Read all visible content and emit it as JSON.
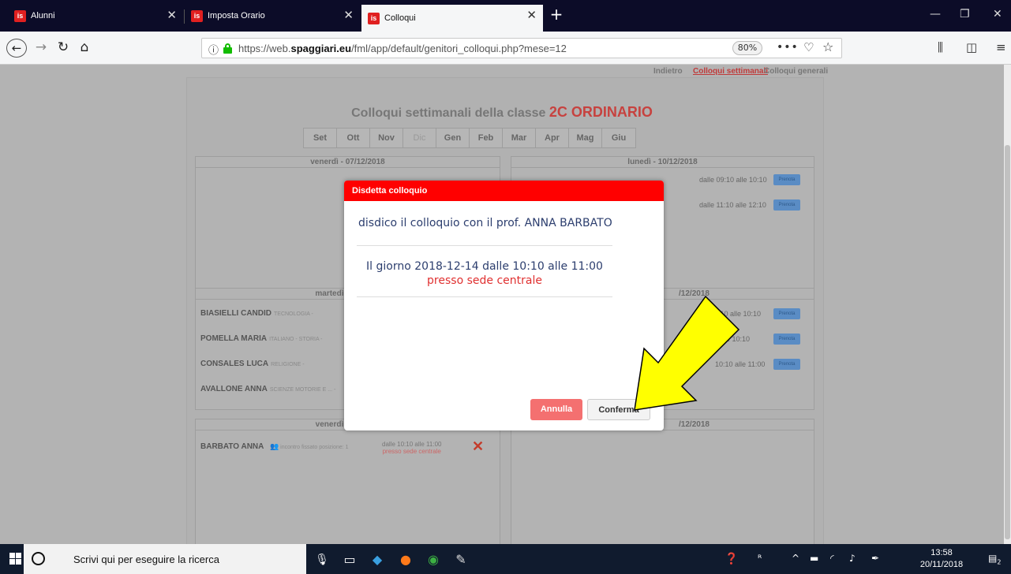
{
  "browser": {
    "tabs": [
      {
        "label": "Alunni",
        "favicon": "is",
        "active": false
      },
      {
        "label": "Imposta Orario",
        "favicon": "is",
        "active": false
      },
      {
        "label": "Colloqui",
        "favicon": "is",
        "active": true
      }
    ],
    "url_prefix": "https://web.",
    "url_domain": "spaggiari.eu",
    "url_path": "/fml/app/default/genitori_colloqui.php?mese=12",
    "zoom": "80%"
  },
  "page": {
    "links": {
      "back": "Indietro",
      "weekly": "Colloqui settimanali",
      "general": "Colloqui generali"
    },
    "title_prefix": "Colloqui settimanali della classe",
    "class_name": "2C ORDINARIO",
    "months": [
      "Set",
      "Ott",
      "Nov",
      "Dic",
      "Gen",
      "Feb",
      "Mar",
      "Apr",
      "Mag",
      "Giu"
    ],
    "current_month": "Dic",
    "days": [
      {
        "header": "venerdì - 07/12/2018"
      },
      {
        "header": "lunedì - 10/12/2018"
      },
      {
        "header": "martedì -"
      },
      {
        "header": "/12/2018"
      },
      {
        "header": "venerdì -"
      },
      {
        "header": "/12/2018"
      }
    ],
    "monday_slots": [
      "dalle 09:10 alle 10:10",
      "dalle 11:10 alle 12:10"
    ],
    "wed_slots": [
      "09:10 alle 10:10",
      "le 10:10",
      "10:10 alle 11:00"
    ],
    "prenota_label": "Prenota",
    "teachers": [
      {
        "name": "BIASIELLI CANDID",
        "subject": "TECNOLOGIA -"
      },
      {
        "name": "POMELLA MARIA",
        "subject": "ITALIANO - STORIA -"
      },
      {
        "name": "CONSALES LUCA",
        "subject": "RELIGIONE -"
      },
      {
        "name": "AVALLONE ANNA",
        "subject": "SCIENZE MOTORIE E ... -"
      }
    ],
    "booked": {
      "name": "BARBATO ANNA",
      "note": "incontro fissato posizione: 1",
      "time": "dalle 10:10 alle 11:00",
      "location": "presso sede centrale"
    }
  },
  "modal": {
    "title": "Disdetta colloquio",
    "message": "disdico il colloquio con il prof. ANNA BARBATO",
    "date_line": "Il giorno 2018-12-14 dalle 10:10 alle 11:00",
    "location": "presso sede centrale",
    "cancel_label": "Annulla",
    "confirm_label": "Conferma"
  },
  "taskbar": {
    "search_placeholder": "Scrivi qui per eseguire la ricerca",
    "time": "13:58",
    "date": "20/11/2018",
    "notifications": "2"
  },
  "colors": {
    "modal_header": "#ff0000",
    "cancel_button": "#f47070",
    "class_name": "#c7423f",
    "arrow": "#ffff00"
  }
}
